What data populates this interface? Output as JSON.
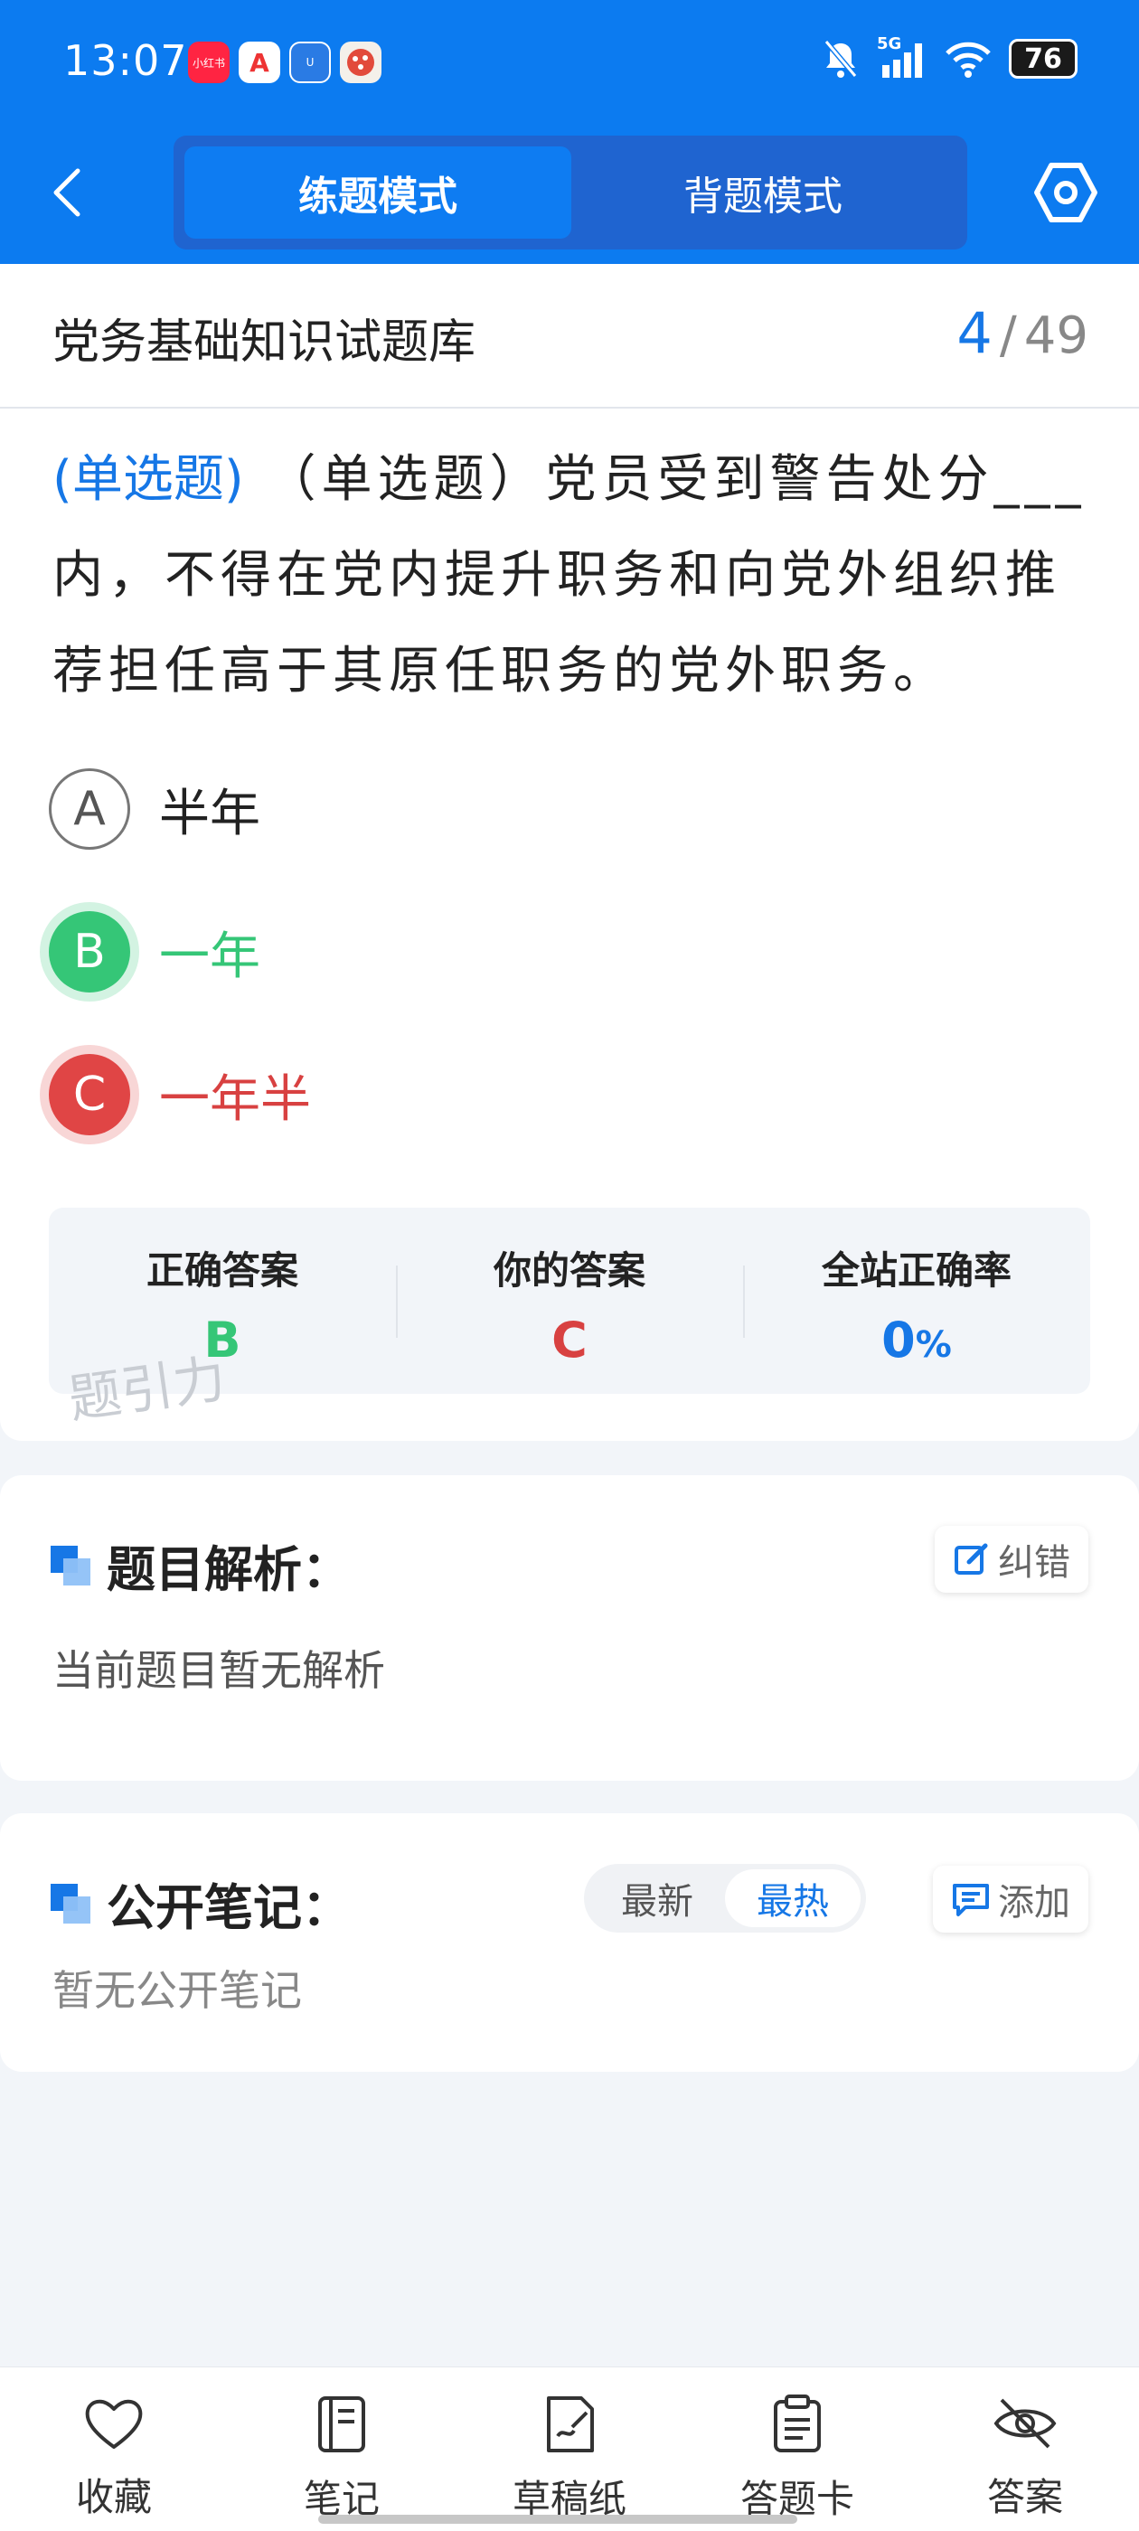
{
  "status_bar": {
    "time": "13:07",
    "app_icons": [
      "小红书",
      "A",
      "U",
      "饿"
    ],
    "network": "5G",
    "battery": "76"
  },
  "nav": {
    "modes": [
      "练题模式",
      "背题模式"
    ],
    "active_mode": "练题模式"
  },
  "question": {
    "bank_title": "党务基础知识试题库",
    "current": "4",
    "separator": "/",
    "total": "49",
    "type_tag": "(单选题)",
    "text": "（单选题）党员受到警告处分___内，不得在党内提升职务和向党外组织推荐担任高于其原任职务的党外职务。",
    "options": [
      {
        "letter": "A",
        "text": "半年",
        "state": "neutral"
      },
      {
        "letter": "B",
        "text": "一年",
        "state": "correct"
      },
      {
        "letter": "C",
        "text": "一年半",
        "state": "wrong"
      }
    ]
  },
  "stats": {
    "correct_label": "正确答案",
    "correct_value": "B",
    "yours_label": "你的答案",
    "yours_value": "C",
    "rate_label": "全站正确率",
    "rate_value": "0",
    "rate_unit": "%"
  },
  "watermark": "题引力",
  "analysis": {
    "title": "题目解析：",
    "report_label": "纠错",
    "empty": "当前题目暂无解析"
  },
  "notes": {
    "title": "公开笔记：",
    "sort_options": [
      "最新",
      "最热"
    ],
    "active_sort": "最热",
    "add_label": "添加",
    "empty": "暂无公开笔记"
  },
  "bottom_bar": [
    {
      "label": "收藏",
      "icon": "heart-icon"
    },
    {
      "label": "笔记",
      "icon": "notebook-icon"
    },
    {
      "label": "草稿纸",
      "icon": "draft-icon"
    },
    {
      "label": "答题卡",
      "icon": "clipboard-icon"
    },
    {
      "label": "答案",
      "icon": "eye-off-icon"
    }
  ],
  "colors": {
    "primary": "#0c7bf0",
    "correct": "#35c677",
    "wrong": "#e04545",
    "background": "#f2f5f9"
  }
}
